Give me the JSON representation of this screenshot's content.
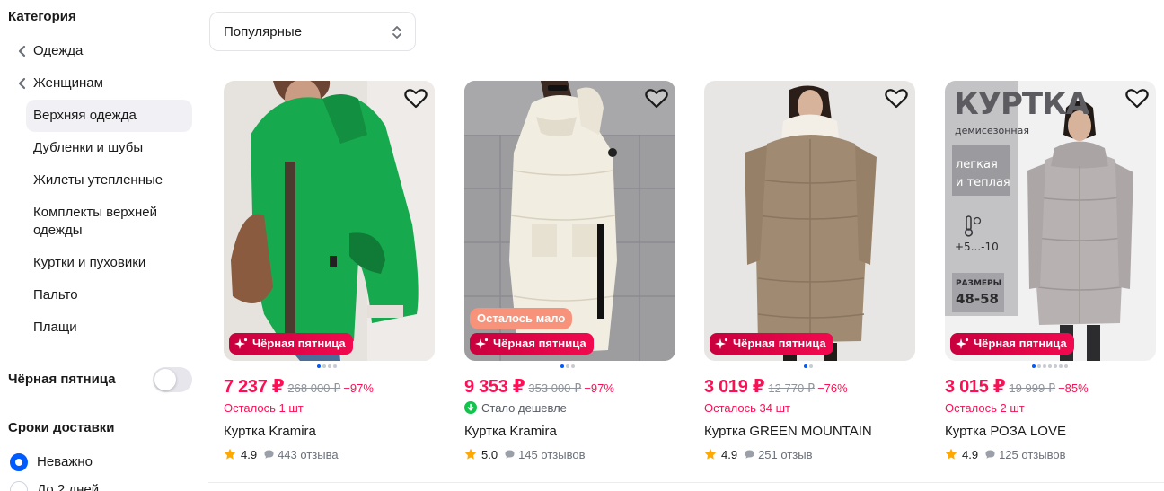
{
  "sidebar": {
    "title": "Категория",
    "items": [
      {
        "label": "Одежда",
        "back": true
      },
      {
        "label": "Женщинам",
        "back": true
      },
      {
        "label": "Верхняя одежда",
        "active": true
      },
      {
        "label": "Дубленки и шубы"
      },
      {
        "label": "Жилеты утепленные"
      },
      {
        "label": "Комплекты верхней одежды"
      },
      {
        "label": "Куртки и пуховики"
      },
      {
        "label": "Пальто"
      },
      {
        "label": "Плащи"
      }
    ],
    "black_friday_toggle": {
      "label": "Чёрная пятница",
      "on": false
    },
    "shipping": {
      "title": "Сроки доставки",
      "options": [
        {
          "label": "Неважно",
          "selected": true
        },
        {
          "label": "До 2 дней",
          "selected": false
        }
      ]
    }
  },
  "sort": {
    "label": "Популярные",
    "icon": "sort-arrows-icon"
  },
  "colors": {
    "price": "#f91155",
    "accent": "#005bff",
    "badge_low": "#f7937a"
  },
  "products": [
    {
      "price": "7 237 ₽",
      "old_price": "268 000 ₽",
      "discount": "−97%",
      "stock": "Осталось 1 шт",
      "name": "Куртка Kramira",
      "rating": "4.9",
      "reviews": "443 отзыва",
      "badge": "Чёрная пятница",
      "dots": 4,
      "current_dot": 0
    },
    {
      "price": "9 353 ₽",
      "old_price": "353 000 ₽",
      "discount": "−97%",
      "cheaper": "Стало дешевле",
      "name": "Куртка Kramira",
      "rating": "5.0",
      "reviews": "145 отзывов",
      "low_badge": "Осталось мало",
      "badge": "Чёрная пятница",
      "dots": 3,
      "current_dot": 0
    },
    {
      "price": "3 019 ₽",
      "old_price": "12 770 ₽",
      "discount": "−76%",
      "stock": "Осталось 34 шт",
      "name": "Куртка GREEN MOUNTAIN",
      "rating": "4.9",
      "reviews": "251 отзыв",
      "badge": "Чёрная пятница",
      "dots": 2,
      "current_dot": 0
    },
    {
      "price": "3 015 ₽",
      "old_price": "19 999 ₽",
      "discount": "−85%",
      "stock": "Осталось 2 шт",
      "name": "Куртка РОЗА LOVE",
      "rating": "4.9",
      "reviews": "125 отзывов",
      "badge": "Чёрная пятница",
      "dots": 7,
      "current_dot": 0,
      "promo": {
        "title": "КУРТКА",
        "subtitle": "демисезонная",
        "tag1": "легкая",
        "tag2": "и теплая",
        "temp": "+5...-10",
        "sizes_label": "РАЗМЕРЫ",
        "sizes": "48-58"
      }
    }
  ]
}
